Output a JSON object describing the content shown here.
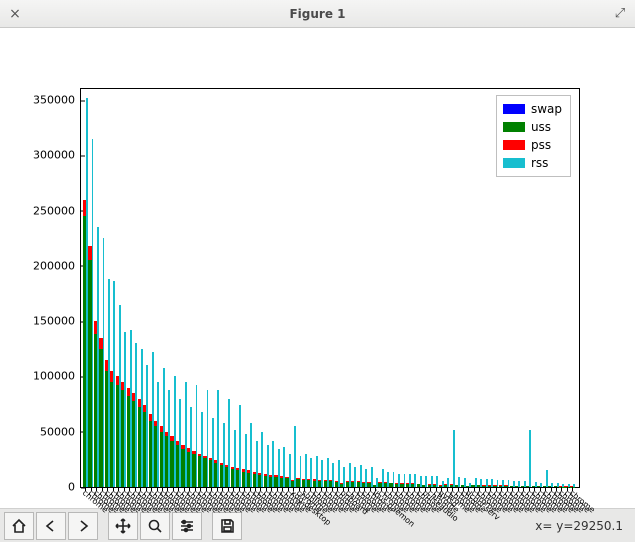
{
  "window": {
    "title": "Figure 1",
    "close_glyph": "×",
    "max_glyph": "⤢"
  },
  "toolbar": {
    "coord_readout": "x= y=29250.1"
  },
  "chart_data": {
    "type": "bar",
    "title": "",
    "xlabel": "",
    "ylabel": "",
    "ylim": [
      0,
      360000
    ],
    "yticks": [
      0,
      50000,
      100000,
      150000,
      200000,
      250000,
      300000,
      350000
    ],
    "legend_position": "upper right",
    "series": [
      {
        "name": "swap",
        "color": "#0000ff"
      },
      {
        "name": "uss",
        "color": "#008000"
      },
      {
        "name": "pss",
        "color": "#ff0000"
      },
      {
        "name": "rss",
        "color": "#17becf"
      }
    ],
    "categories": [
      "chrome",
      "chrome",
      "chrome",
      "chrome",
      "chrome",
      "chrome",
      "chrome",
      "chrome",
      "chrome",
      "chrome",
      "chrome",
      "chrome",
      "chrome",
      "chrome",
      "chrome",
      "chrome",
      "chrome",
      "chrome",
      "chrome",
      "chrome",
      "chrome",
      "chrome",
      "chrome",
      "chrome",
      "chrome",
      "chrome",
      "chrome",
      "chrome",
      "chrome",
      "chrome",
      "chrome",
      "chrome",
      "chrome",
      "chrome",
      "chrome",
      "chrome",
      "chrome",
      "chrome",
      "xdg-desktop",
      "chrome",
      "sublime",
      "chrome",
      "chrome",
      "chrome",
      "chrome",
      "chrome",
      "chrome",
      "onboard",
      "chrome",
      "chrome",
      "chrome",
      "chrome",
      "chrome",
      "ibus-daemon",
      "chrome",
      "chrome",
      "chrome",
      "chrome",
      "chrome",
      "chrome",
      "chrome",
      "chrome",
      "pulseaudio",
      "chrome",
      "chrome",
      "gvfsd",
      "chrome",
      "chrome",
      "chrome",
      "chrome",
      "dconf-serv",
      "chrome",
      "chrome",
      "chrome",
      "chrome",
      "chrome",
      "chrome",
      "chrome",
      "chrome",
      "chrome",
      "chrome",
      "chrome",
      "chrome",
      "chrome",
      "chrome",
      "chrome",
      "chrome",
      "chrome",
      "chrome",
      "chrome"
    ],
    "data": {
      "swap": [
        0,
        0,
        0,
        0,
        0,
        0,
        0,
        0,
        0,
        0,
        0,
        0,
        0,
        0,
        0,
        0,
        0,
        0,
        0,
        0,
        0,
        0,
        0,
        0,
        0,
        0,
        0,
        0,
        0,
        0,
        0,
        0,
        0,
        0,
        0,
        0,
        0,
        0,
        0,
        0,
        0,
        0,
        0,
        0,
        0,
        0,
        0,
        0,
        0,
        0,
        0,
        0,
        0,
        0,
        0,
        0,
        0,
        0,
        0,
        0,
        0,
        0,
        0,
        0,
        0,
        0,
        0,
        0,
        0,
        0,
        0,
        0,
        0,
        0,
        0,
        0,
        0,
        0,
        0,
        0,
        0,
        0,
        0,
        0,
        0,
        0,
        0,
        0,
        0,
        0
      ],
      "uss": [
        245000,
        205000,
        138000,
        125000,
        105000,
        95000,
        92000,
        88000,
        82000,
        78000,
        72000,
        68000,
        60000,
        55000,
        50000,
        46000,
        42000,
        38000,
        34000,
        32000,
        30000,
        28000,
        26000,
        24000,
        22000,
        20000,
        18000,
        16000,
        15000,
        14000,
        13000,
        12000,
        11000,
        10000,
        9500,
        9000,
        8500,
        8000,
        5000,
        7000,
        6000,
        6000,
        5800,
        5500,
        5200,
        5000,
        4800,
        3000,
        4600,
        4400,
        4200,
        4000,
        3800,
        1500,
        3600,
        3400,
        3200,
        3000,
        2800,
        2700,
        2500,
        2400,
        1500,
        2200,
        2000,
        1200,
        1900,
        1800,
        1700,
        1600,
        800,
        1500,
        1400,
        1300,
        1200,
        1100,
        1000,
        950,
        900,
        850,
        800,
        850,
        700,
        650,
        600,
        550,
        500,
        450,
        400,
        350
      ],
      "pss": [
        260000,
        218000,
        150000,
        135000,
        115000,
        105000,
        100000,
        95000,
        90000,
        85000,
        80000,
        74000,
        66000,
        60000,
        55000,
        50000,
        46000,
        42000,
        38000,
        35000,
        33000,
        30000,
        28000,
        26000,
        24000,
        22000,
        20000,
        18000,
        17000,
        16000,
        15000,
        14000,
        13000,
        12000,
        11000,
        10500,
        10000,
        9500,
        6000,
        8500,
        7500,
        7000,
        6800,
        6500,
        6200,
        6000,
        5800,
        4000,
        5500,
        5300,
        5000,
        4800,
        4600,
        2000,
        4400,
        4200,
        4000,
        3800,
        3600,
        3400,
        3200,
        3000,
        2000,
        2800,
        2600,
        1500,
        2500,
        2400,
        2200,
        2100,
        1000,
        2000,
        1900,
        1800,
        1700,
        1600,
        1500,
        1400,
        1300,
        1250,
        1200,
        1250,
        1050,
        1000,
        950,
        900,
        850,
        800,
        750,
        700
      ],
      "rss": [
        352000,
        315000,
        235000,
        225000,
        188000,
        186000,
        165000,
        140000,
        142000,
        130000,
        125000,
        110000,
        122000,
        95000,
        108000,
        88000,
        100000,
        80000,
        95000,
        72000,
        92000,
        68000,
        88000,
        62000,
        88000,
        58000,
        80000,
        52000,
        74000,
        48000,
        58000,
        42000,
        50000,
        38000,
        42000,
        34000,
        36000,
        30000,
        55000,
        28000,
        30000,
        26000,
        28000,
        24000,
        26000,
        22000,
        24000,
        18000,
        22000,
        18000,
        20000,
        16000,
        18000,
        8000,
        16000,
        14000,
        14000,
        12000,
        12000,
        12000,
        12000,
        10000,
        10000,
        10000,
        10000,
        5000,
        8000,
        52000,
        9000,
        8000,
        4000,
        8000,
        7500,
        7000,
        7000,
        6500,
        6000,
        6000,
        5500,
        5500,
        5000,
        52000,
        4500,
        4000,
        15000,
        4000,
        3500,
        3000,
        3000,
        3000
      ]
    }
  }
}
